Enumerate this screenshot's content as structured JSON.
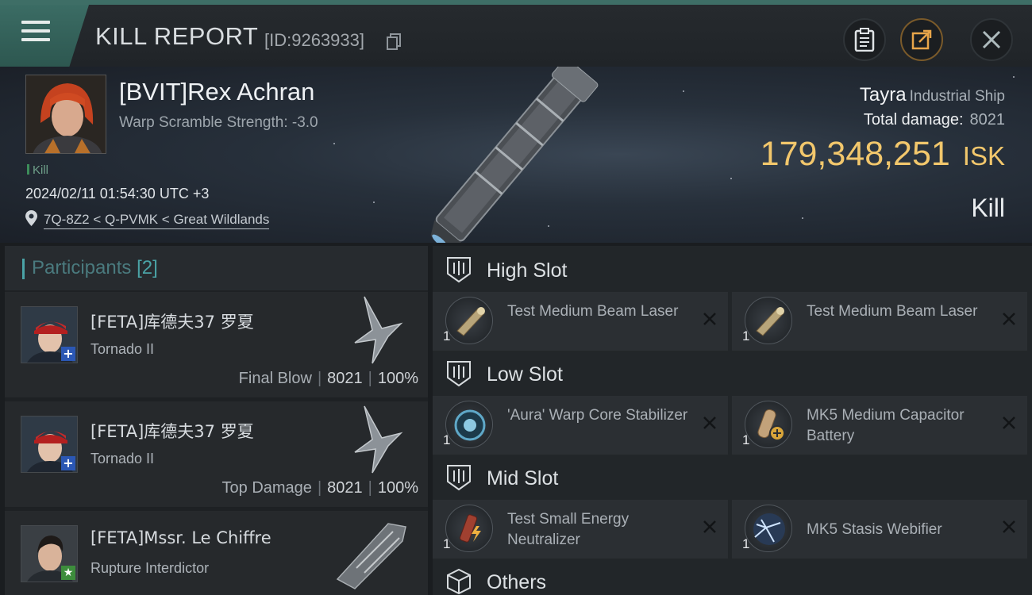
{
  "header": {
    "title": "KILL REPORT",
    "report_id": "[ID:9263933]"
  },
  "victim": {
    "name": "[BVIT]Rex Achran",
    "warp_scramble": "Warp Scramble Strength: -3.0",
    "kill_tag": "Kill",
    "timestamp": "2024/02/11 01:54:30 UTC +3",
    "location": "7Q-8Z2 < Q-PVMK < Great Wildlands"
  },
  "summary": {
    "ship_name": "Tayra",
    "ship_class": "Industrial Ship",
    "total_damage_label": "Total damage:",
    "total_damage_value": "8021",
    "isk_value": "179,348,251",
    "isk_unit": "ISK",
    "result": "Kill"
  },
  "participants": {
    "title": "Participants",
    "count": "[2]",
    "rows": [
      {
        "name": "[FETA]库德夫37 罗夏",
        "ship": "Tornado II",
        "label": "Final Blow",
        "damage": "8021",
        "percent": "100%"
      },
      {
        "name": "[FETA]库德夫37 罗夏",
        "ship": "Tornado II",
        "label": "Top Damage",
        "damage": "8021",
        "percent": "100%"
      },
      {
        "name": "[FETA]Mssr. Le Chiffre",
        "ship": "Rupture Interdictor"
      }
    ]
  },
  "fitting": {
    "high_slot": {
      "title": "High Slot",
      "modules": [
        {
          "qty": "1",
          "name": "Test Medium Beam Laser",
          "icon": "beam-laser-icon"
        },
        {
          "qty": "1",
          "name": "Test Medium Beam Laser",
          "icon": "beam-laser-icon"
        }
      ]
    },
    "low_slot": {
      "title": "Low Slot",
      "modules": [
        {
          "qty": "1",
          "name": "'Aura' Warp Core Stabilizer",
          "icon": "warp-core-stabilizer-icon"
        },
        {
          "qty": "1",
          "name": "MK5 Medium Capacitor Battery",
          "icon": "capacitor-battery-icon"
        }
      ]
    },
    "mid_slot": {
      "title": "Mid Slot",
      "modules": [
        {
          "qty": "1",
          "name": "Test Small Energy Neutralizer",
          "icon": "energy-neutralizer-icon"
        },
        {
          "qty": "1",
          "name": "MK5 Stasis Webifier",
          "icon": "stasis-webifier-icon"
        }
      ]
    },
    "others": {
      "title": "Others"
    }
  },
  "colors": {
    "accent_teal": "#4aa3a6",
    "isk_gold": "#f2c76c",
    "header_green": "#3b6c64"
  }
}
